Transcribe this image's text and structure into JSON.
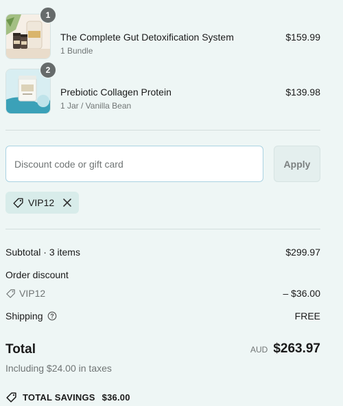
{
  "line_items": [
    {
      "quantity": "1",
      "title": "The Complete Gut Detoxification System",
      "variant": "1 Bundle",
      "price": "$159.99"
    },
    {
      "quantity": "2",
      "title": "Prebiotic Collagen Protein",
      "variant": "1 Jar / Vanilla Bean",
      "price": "$139.98"
    }
  ],
  "discount_form": {
    "placeholder": "Discount code or gift card",
    "value": "",
    "apply_label": "Apply",
    "applied_code": "VIP12"
  },
  "summary": {
    "subtotal_label": "Subtotal · 3 items",
    "subtotal_value": "$299.97",
    "order_discount_label": "Order discount",
    "discount_code": "VIP12",
    "discount_value": "– $36.00",
    "shipping_label": "Shipping",
    "shipping_value": "FREE",
    "total_label": "Total",
    "currency": "AUD",
    "total_value": "$263.97",
    "tax_note": "Including $24.00 in taxes",
    "savings_label": "TOTAL SAVINGS",
    "savings_value": "$36.00"
  },
  "colors": {
    "background": "#eef6f5",
    "badge": "#666b6b",
    "tag_background": "#d8ecea",
    "input_border": "#a9d2e2",
    "muted_text": "#707575"
  }
}
